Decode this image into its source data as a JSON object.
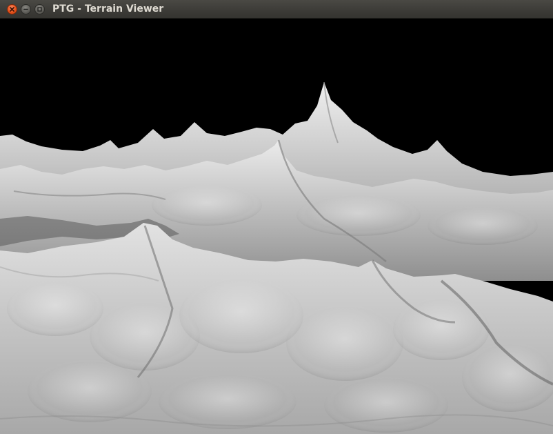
{
  "window": {
    "title": "PTG - Terrain Viewer",
    "buttons": [
      {
        "name": "close",
        "icon": "close-icon"
      },
      {
        "name": "minimize",
        "icon": "minimize-icon"
      },
      {
        "name": "maximize",
        "icon": "maximize-icon"
      }
    ]
  },
  "viewport": {
    "background_color": "#000000",
    "terrain_color": "#d9d9d9"
  }
}
